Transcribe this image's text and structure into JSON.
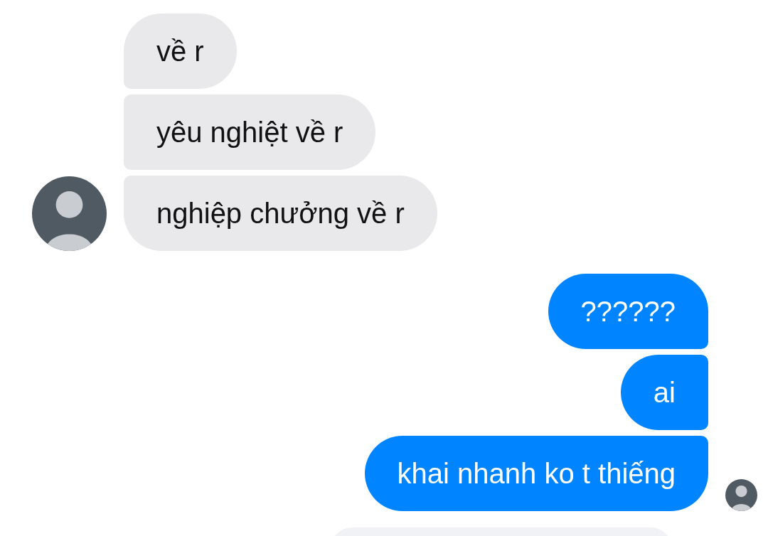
{
  "groups": [
    {
      "kind": "incoming",
      "messages": [
        "về r",
        "yêu nghiệt về r",
        "nghiệp chưởng về r"
      ]
    },
    {
      "kind": "outgoing",
      "messages": [
        "??????",
        "ai",
        "khai nhanh ko t thiếng"
      ]
    }
  ],
  "trailing_item": {
    "kind": "cut_off_bubble"
  }
}
